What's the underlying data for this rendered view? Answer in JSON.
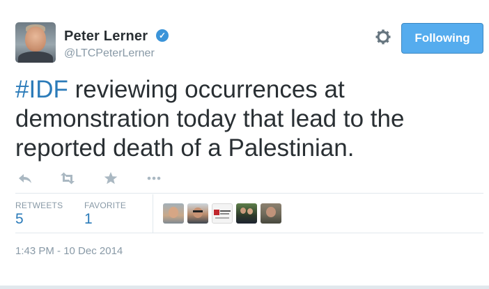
{
  "author": {
    "name": "Peter Lerner",
    "handle": "@LTCPeterLerner",
    "verified": true
  },
  "follow_button": {
    "label": "Following"
  },
  "tweet": {
    "hashtag": "#IDF",
    "text": " reviewing occurrences at demonstration today that lead to the reported death of a Palestinian."
  },
  "actions": {
    "icons": [
      "reply-icon",
      "retweet-icon",
      "favorite-icon",
      "more-icon"
    ]
  },
  "stats": {
    "retweets_label": "RETWEETS",
    "retweets_count": "5",
    "favorites_label": "FAVORITE",
    "favorites_count": "1"
  },
  "favorited_by_avatars": 5,
  "timestamp": "1:43 PM - 10 Dec 2014",
  "colors": {
    "link": "#2b7bb9",
    "button_bg": "#55acee",
    "muted": "#8899a6",
    "verified": "#3b94d9"
  }
}
